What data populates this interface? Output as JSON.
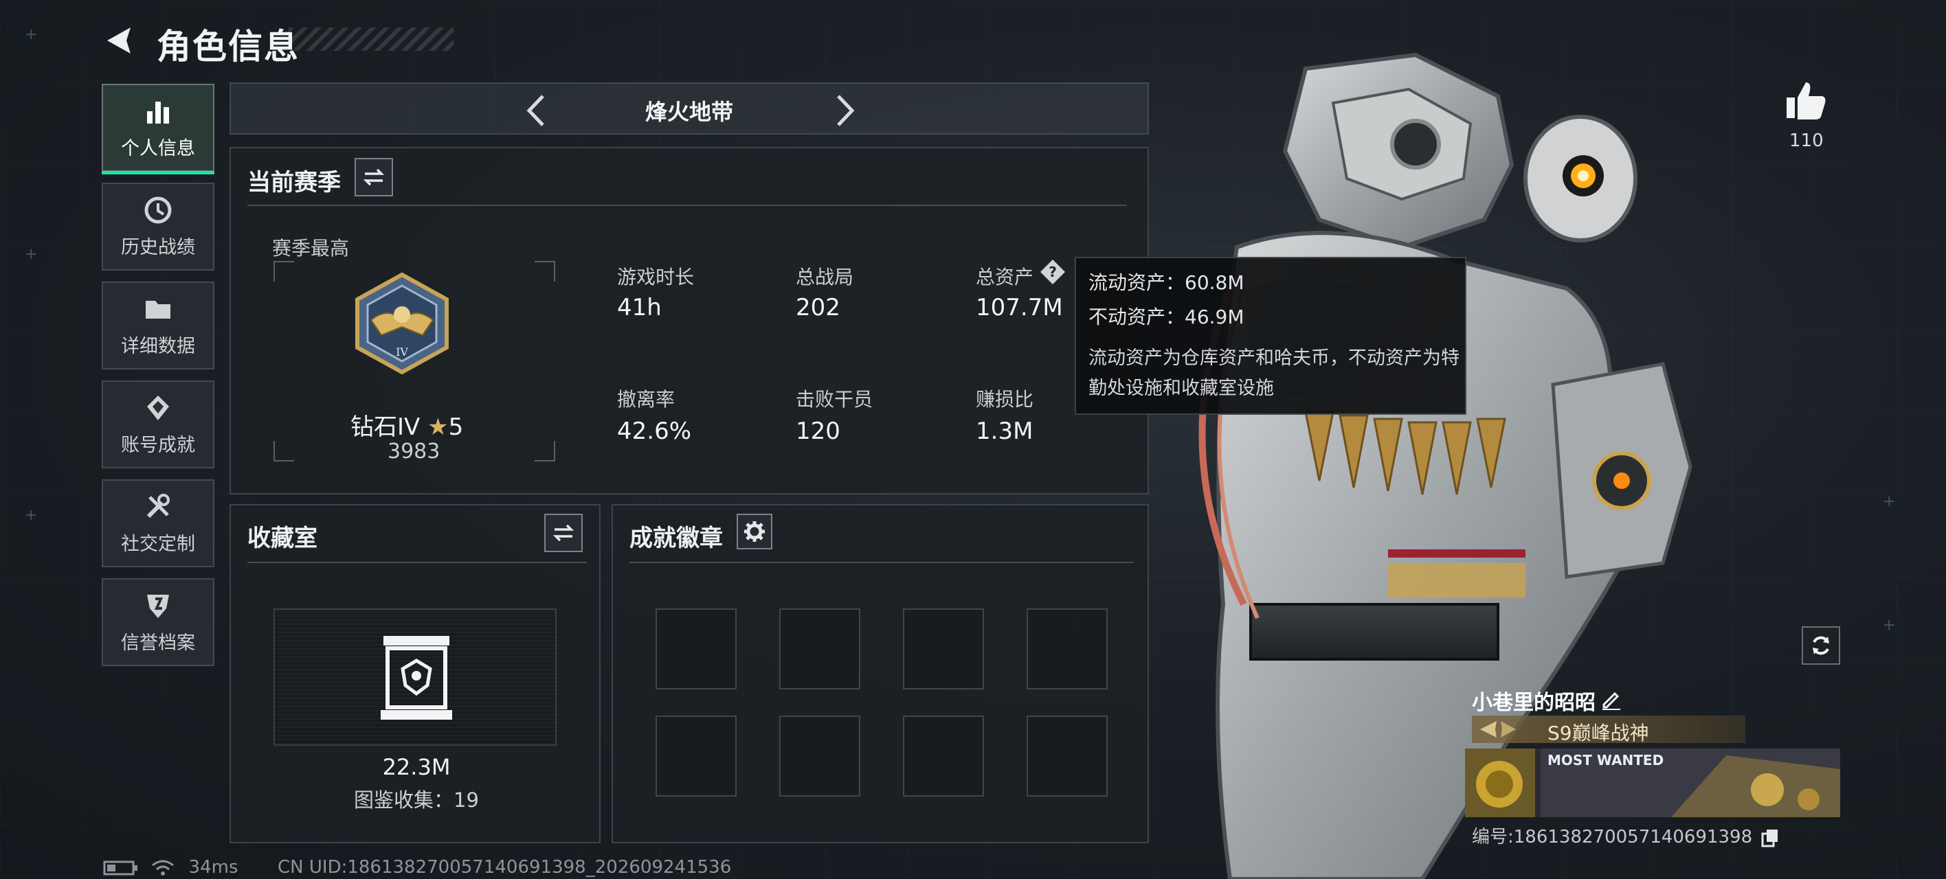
{
  "header": {
    "title": "角色信息"
  },
  "sidebar": {
    "items": [
      {
        "label": "个人信息",
        "icon": "bar-chart-icon",
        "active": true
      },
      {
        "label": "历史战绩",
        "icon": "history-icon"
      },
      {
        "label": "详细数据",
        "icon": "folder-icon"
      },
      {
        "label": "账号成就",
        "icon": "medal-icon"
      },
      {
        "label": "社交定制",
        "icon": "tools-icon"
      },
      {
        "label": "信誉档案",
        "icon": "shield-icon"
      }
    ]
  },
  "mode": {
    "title": "烽火地带"
  },
  "season": {
    "title": "当前赛季",
    "highest_label": "赛季最高",
    "rank_name": "钻石IV",
    "rank_stars": "5",
    "rank_score": "3983",
    "stats": [
      {
        "label": "游戏时长",
        "value": "41h"
      },
      {
        "label": "总战局",
        "value": "202"
      },
      {
        "label": "总资产",
        "value": "107.7M"
      },
      {
        "label": "撤离率",
        "value": "42.6%"
      },
      {
        "label": "击败干员",
        "value": "120"
      },
      {
        "label": "赚损比",
        "value": "1.3M"
      }
    ]
  },
  "tooltip": {
    "liquid": "流动资产：60.8M",
    "fixed": "不动资产：46.9M",
    "desc": "流动资产为仓库资产和哈夫币，不动资产为特勤处设施和收藏室设施"
  },
  "collection": {
    "title": "收藏室",
    "value": "22.3M",
    "count": "图鉴收集：19"
  },
  "achievements": {
    "title": "成就徽章"
  },
  "profile": {
    "likes": "110",
    "name": "小巷里的昭昭",
    "title": "S9巅峰战神",
    "banner_text": "MOST WANTED",
    "id": "编号:1861382700571406913​98"
  },
  "status": {
    "latency": "34ms",
    "uid": "CN UID:186138270057140691398_202609241536"
  },
  "colors": {
    "accent": "#23e0a0"
  }
}
